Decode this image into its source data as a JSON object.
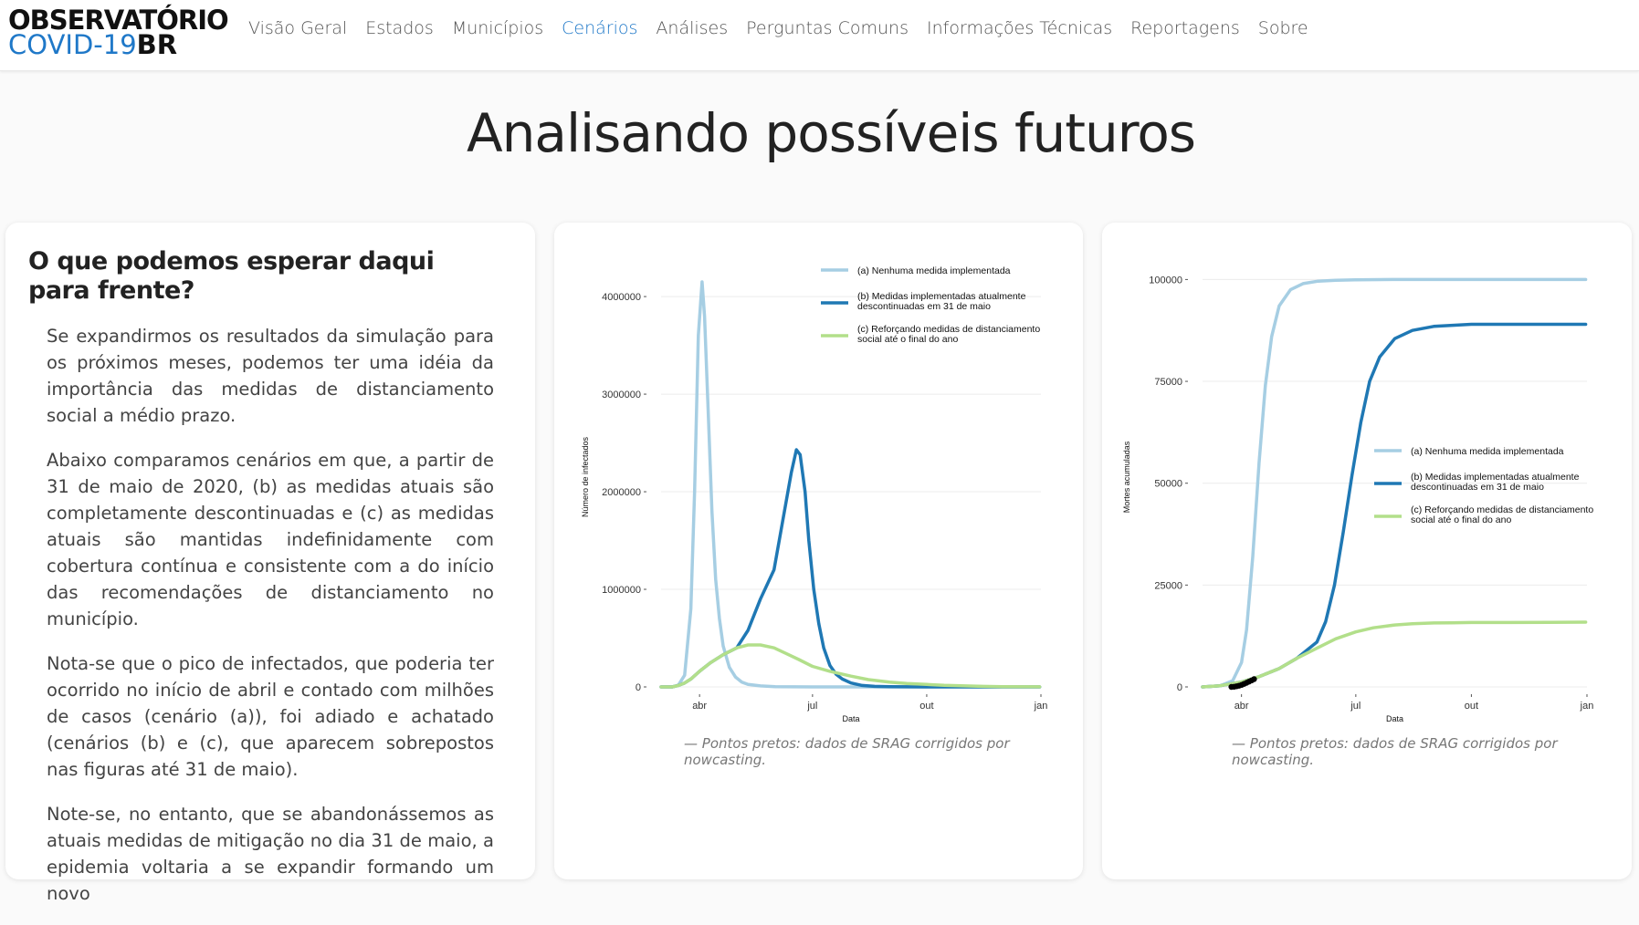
{
  "logo": {
    "line1": "OBSERVATÓRIO",
    "line2a": "COVID-19",
    "line2b": "BR"
  },
  "nav": [
    {
      "label": "Visão Geral"
    },
    {
      "label": "Estados"
    },
    {
      "label": "Municípios"
    },
    {
      "label": "Cenários",
      "active": true
    },
    {
      "label": "Análises"
    },
    {
      "label": "Perguntas Comuns"
    },
    {
      "label": "Informações Técnicas"
    },
    {
      "label": "Reportagens"
    },
    {
      "label": "Sobre"
    }
  ],
  "page_title": "Analisando possíveis futuros",
  "text_card": {
    "heading": "O que podemos esperar daqui para frente?",
    "paragraphs": [
      "Se expandirmos os resultados da simulação para os próximos meses, podemos ter uma idéia da importância das medidas de distanciamento social a médio prazo.",
      "Abaixo comparamos cenários em que, a partir de 31 de maio de 2020, (b) as medidas atuais são completamente descontinuadas e (c) as medidas atuais são mantidas indefinidamente com cobertura contínua e consistente com a do início das recomendações de distanciamento no município.",
      "Nota-se que o pico de infectados, que poderia ter ocorrido no início de abril e contado com milhões de casos (cenário (a)), foi adiado e achatado (cenários (b) e (c), que aparecem sobrepostos nas figuras até 31 de maio).",
      "Note-se, no entanto, que se abandonássemos as atuais medidas de mitigação no dia 31 de maio, a epidemia voltaria a se expandir formando um novo"
    ]
  },
  "colors": {
    "accent": "#1f78c8",
    "light_blue": "#a6cee3",
    "dark_blue": "#1f78b4",
    "green": "#b2df8a"
  },
  "chart_data": [
    {
      "type": "line",
      "xlabel": "Data",
      "ylabel": "Número de infectados",
      "x_ticks": [
        "abr",
        "jul",
        "out",
        "jan"
      ],
      "y_ticks": [
        "0",
        "1000000",
        "2000000",
        "3000000",
        "4000000"
      ],
      "ylim": [
        0,
        4300000
      ],
      "legend_position": "top-right",
      "caption": "— Pontos pretos: dados de SRAG corrigidos por nowcasting.",
      "series": [
        {
          "name": "(a) Nenhuma medida implementada",
          "color": "#a6cee3",
          "x": [
            "03-01",
            "03-10",
            "03-15",
            "03-20",
            "03-25",
            "03-28",
            "03-31",
            "04-03",
            "04-05",
            "04-08",
            "04-11",
            "04-14",
            "04-17",
            "04-20",
            "04-25",
            "04-30",
            "05-05",
            "05-10",
            "05-20",
            "06-01",
            "07-01",
            "10-01",
            "12-31"
          ],
          "values": [
            0,
            0,
            20000,
            120000,
            800000,
            2000000,
            3600000,
            4150000,
            3800000,
            2800000,
            1800000,
            1100000,
            700000,
            420000,
            200000,
            100000,
            50000,
            25000,
            10000,
            3000,
            0,
            0,
            0
          ]
        },
        {
          "name": "(b) Medidas implementadas atualmente descontinuadas em 31 de maio",
          "color": "#1f78b4",
          "x": [
            "03-01",
            "03-10",
            "03-15",
            "03-20",
            "03-25",
            "04-01",
            "04-10",
            "04-20",
            "05-01",
            "05-10",
            "05-20",
            "05-31",
            "06-07",
            "06-14",
            "06-18",
            "06-21",
            "06-25",
            "06-28",
            "07-02",
            "07-06",
            "07-10",
            "07-15",
            "07-20",
            "07-25",
            "08-01",
            "08-10",
            "08-20",
            "09-01",
            "10-01",
            "11-01",
            "12-31"
          ],
          "values": [
            0,
            0,
            15000,
            40000,
            80000,
            160000,
            250000,
            330000,
            400000,
            580000,
            900000,
            1200000,
            1700000,
            2200000,
            2430000,
            2380000,
            2000000,
            1500000,
            1000000,
            650000,
            400000,
            220000,
            130000,
            80000,
            40000,
            15000,
            6000,
            2000,
            0,
            0,
            0
          ]
        },
        {
          "name": "(c) Reforçando medidas de distanciamento social até o final do ano",
          "color": "#b2df8a",
          "x": [
            "03-01",
            "03-10",
            "03-15",
            "03-20",
            "03-25",
            "04-01",
            "04-10",
            "04-20",
            "05-01",
            "05-10",
            "05-20",
            "05-31",
            "06-10",
            "06-20",
            "07-01",
            "07-15",
            "08-01",
            "08-15",
            "09-01",
            "09-15",
            "10-01",
            "10-15",
            "11-01",
            "11-15",
            "12-01",
            "12-31"
          ],
          "values": [
            0,
            0,
            15000,
            40000,
            80000,
            160000,
            250000,
            330000,
            400000,
            430000,
            430000,
            400000,
            340000,
            280000,
            210000,
            160000,
            110000,
            75000,
            50000,
            35000,
            25000,
            16000,
            10000,
            6000,
            3000,
            1000
          ]
        }
      ]
    },
    {
      "type": "line",
      "xlabel": "Data",
      "ylabel": "Mortes acumuladas",
      "x_ticks": [
        "abr",
        "jul",
        "out",
        "jan"
      ],
      "y_ticks": [
        "0",
        "25000",
        "50000",
        "75000",
        "100000"
      ],
      "ylim": [
        0,
        103000
      ],
      "legend_position": "right",
      "caption": "— Pontos pretos: dados de SRAG corrigidos por nowcasting.",
      "series": [
        {
          "name": "(a) Nenhuma medida implementada",
          "color": "#a6cee3",
          "x": [
            "03-01",
            "03-15",
            "03-25",
            "04-01",
            "04-05",
            "04-10",
            "04-15",
            "04-20",
            "04-25",
            "05-01",
            "05-10",
            "05-20",
            "06-01",
            "06-15",
            "07-01",
            "08-01",
            "10-01",
            "12-31"
          ],
          "values": [
            0,
            300,
            1500,
            6000,
            14000,
            32000,
            55000,
            74000,
            86000,
            93500,
            97500,
            99000,
            99600,
            99800,
            99900,
            100000,
            100000,
            100000
          ]
        },
        {
          "name": "(b) Medidas implementadas atualmente descontinuadas em 31 de maio",
          "color": "#1f78b4",
          "x": [
            "03-01",
            "03-15",
            "04-01",
            "04-15",
            "05-01",
            "05-15",
            "05-31",
            "06-07",
            "06-14",
            "06-21",
            "06-28",
            "07-05",
            "07-12",
            "07-20",
            "08-01",
            "08-15",
            "09-01",
            "10-01",
            "11-01",
            "12-31"
          ],
          "values": [
            0,
            300,
            1200,
            2500,
            4500,
            7000,
            11000,
            16000,
            25000,
            38000,
            52000,
            65000,
            75000,
            81000,
            85500,
            87500,
            88500,
            89000,
            89000,
            89000
          ]
        },
        {
          "name": "(c) Reforçando medidas de distanciamento social até o final do ano",
          "color": "#b2df8a",
          "x": [
            "03-01",
            "03-15",
            "04-01",
            "04-15",
            "05-01",
            "05-15",
            "05-31",
            "06-15",
            "07-01",
            "07-15",
            "08-01",
            "08-15",
            "09-01",
            "09-15",
            "10-01",
            "11-01",
            "12-01",
            "12-31"
          ],
          "values": [
            0,
            300,
            1200,
            2500,
            4500,
            7000,
            9500,
            11800,
            13500,
            14500,
            15200,
            15500,
            15700,
            15750,
            15800,
            15800,
            15850,
            15900
          ]
        },
        {
          "name": "",
          "color": "#000000",
          "markers": true,
          "x": [
            "03-24",
            "03-26",
            "03-28",
            "03-30",
            "04-01",
            "04-03",
            "04-05",
            "04-07",
            "04-09",
            "04-11"
          ],
          "values": [
            0,
            50,
            150,
            300,
            500,
            750,
            1000,
            1300,
            1600,
            1900
          ]
        }
      ]
    }
  ]
}
